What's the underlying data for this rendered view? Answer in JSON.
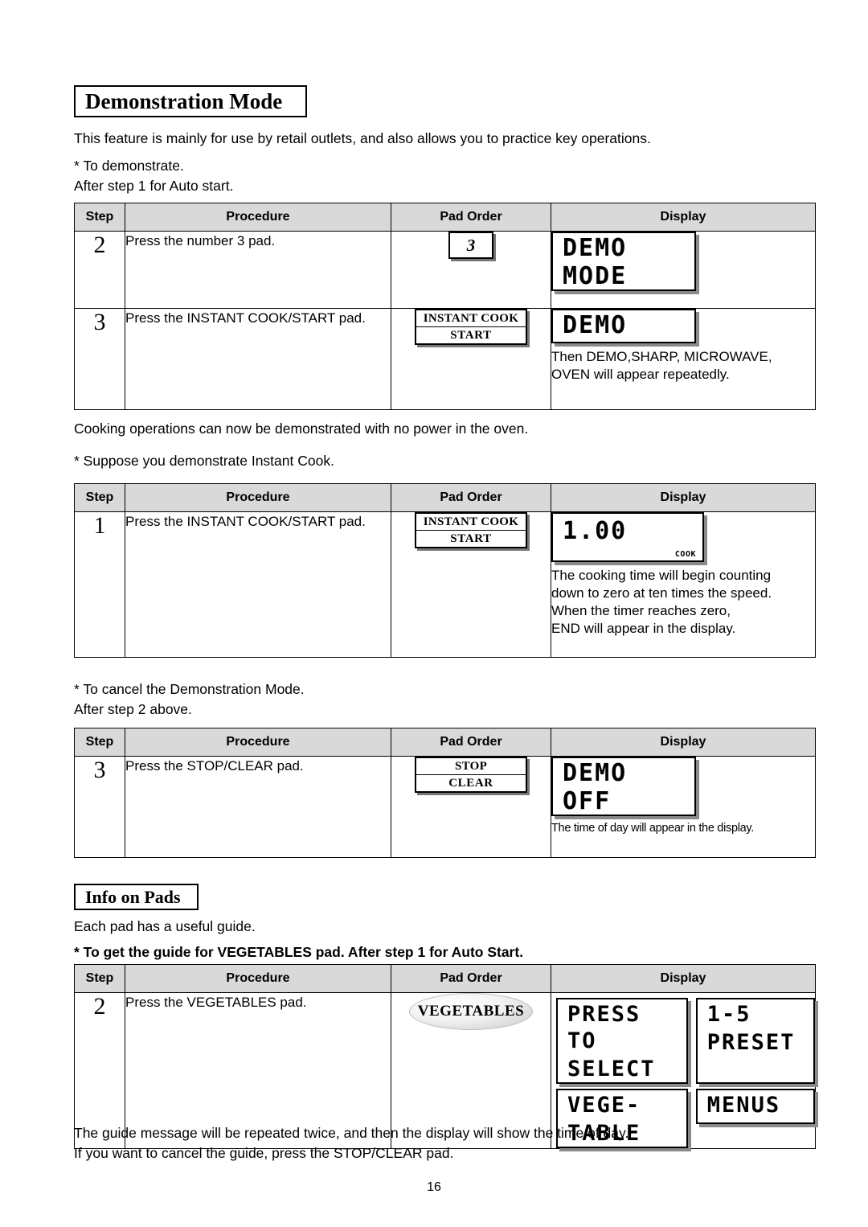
{
  "document": {
    "page_number": "16"
  },
  "sections": {
    "demo": {
      "heading": "Demonstration Mode",
      "intro": "This feature is mainly for use by retail outlets, and also allows you to practice key operations.",
      "subhead1": "* To demonstrate.\nAfter step 1 for Auto start.",
      "after_table1": "Cooking operations can now be demonstrated with no power in the oven.",
      "subhead2": "* Suppose you demonstrate Instant Cook.",
      "subhead3": "* To cancel the Demonstration Mode.\nAfter step 2 above."
    },
    "info": {
      "heading": "Info on Pads",
      "intro": "Each pad has a useful guide.",
      "subhead": "* To get the guide for VEGETABLES pad. After step 1 for Auto Start.",
      "closing": "The guide message will be repeated twice, and then the display will show the time of day.\nIf you want to cancel the guide, press the STOP/CLEAR pad."
    }
  },
  "table_headers": {
    "step": "Step",
    "procedure": "Procedure",
    "pad_order": "Pad Order",
    "display": "Display"
  },
  "tables": {
    "demo_enter": {
      "rows": [
        {
          "step": "2",
          "procedure": "Press the number 3 pad.",
          "pad": {
            "type": "number",
            "label": "3"
          },
          "display": {
            "lines": [
              "DEMO",
              "MODE"
            ],
            "note": ""
          }
        },
        {
          "step": "3",
          "procedure": "Press the INSTANT COOK/START pad.",
          "pad": {
            "type": "two-line",
            "line1": "INSTANT COOK",
            "line2": "START"
          },
          "display": {
            "lines": [
              "DEMO"
            ],
            "note": "Then DEMO,SHARP, MICROWAVE,\nOVEN will appear repeatedly."
          }
        }
      ]
    },
    "instant_cook": {
      "rows": [
        {
          "step": "1",
          "procedure": "Press the INSTANT COOK/START pad.",
          "pad": {
            "type": "two-line",
            "line1": "INSTANT COOK",
            "line2": "START"
          },
          "display": {
            "lines": [
              "1.00"
            ],
            "badge": "COOK",
            "note": "The cooking time will begin counting\ndown to zero at ten times the speed.\nWhen the timer reaches zero,\nEND will appear in the display."
          }
        }
      ]
    },
    "cancel_demo": {
      "rows": [
        {
          "step": "3",
          "procedure": "Press the STOP/CLEAR pad.",
          "pad": {
            "type": "two-line",
            "line1": "STOP",
            "line2": "CLEAR"
          },
          "display": {
            "lines": [
              "DEMO",
              "OFF"
            ],
            "note": "The time of day will appear in the display."
          }
        }
      ]
    },
    "vegetables": {
      "rows": [
        {
          "step": "2",
          "procedure": "Press the VEGETABLES pad.",
          "pad": {
            "type": "oval",
            "label": "VEGETABLES"
          },
          "display": {
            "grid": [
              [
                "PRESS TO",
                "1-5"
              ],
              [
                "SELECT",
                "PRESET"
              ],
              [
                "VEGE-",
                "MENUS"
              ],
              [
                "TABLE",
                ""
              ]
            ]
          }
        }
      ]
    }
  }
}
